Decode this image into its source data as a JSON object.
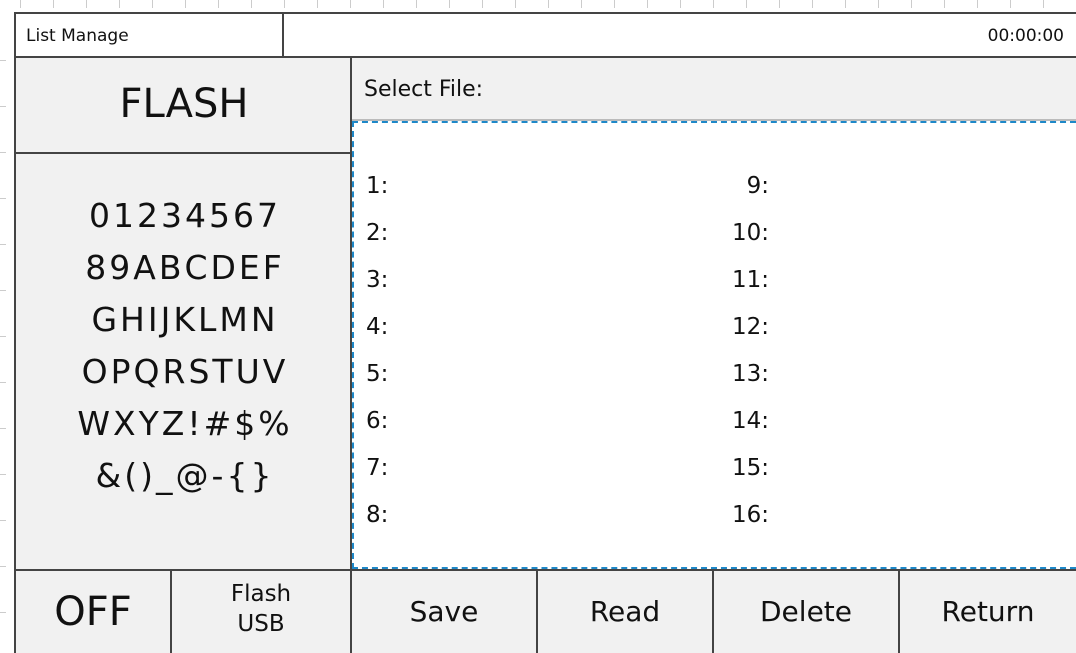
{
  "header": {
    "title": "List Manage",
    "time": "00:00:00"
  },
  "left_panel": {
    "mode": "FLASH",
    "keypad_rows": [
      [
        "0",
        "1",
        "2",
        "3",
        "4",
        "5",
        "6",
        "7"
      ],
      [
        "8",
        "9",
        "A",
        "B",
        "C",
        "D",
        "E",
        "F"
      ],
      [
        "G",
        "H",
        "I",
        "J",
        "K",
        "L",
        "M",
        "N"
      ],
      [
        "O",
        "P",
        "Q",
        "R",
        "S",
        "T",
        "U",
        "V"
      ],
      [
        "W",
        "X",
        "Y",
        "Z",
        "!",
        "#",
        "$",
        "%"
      ],
      [
        "&",
        "(",
        ")",
        "_",
        "@",
        "-",
        "{",
        "}"
      ]
    ]
  },
  "main": {
    "select_label": "Select File:",
    "files_col1": [
      "1:",
      "2:",
      "3:",
      "4:",
      "5:",
      "6:",
      "7:",
      "8:"
    ],
    "files_col2": [
      "9:",
      "10:",
      "11:",
      "12:",
      "13:",
      "14:",
      "15:",
      "16:"
    ]
  },
  "footer": {
    "off": "OFF",
    "flash_usb_line1": "Flash",
    "flash_usb_line2": "USB",
    "save": "Save",
    "read": "Read",
    "delete": "Delete",
    "return": "Return"
  },
  "colors": {
    "border": "#444444",
    "panel": "#f1f1f1",
    "selection": "#1e88c8"
  }
}
